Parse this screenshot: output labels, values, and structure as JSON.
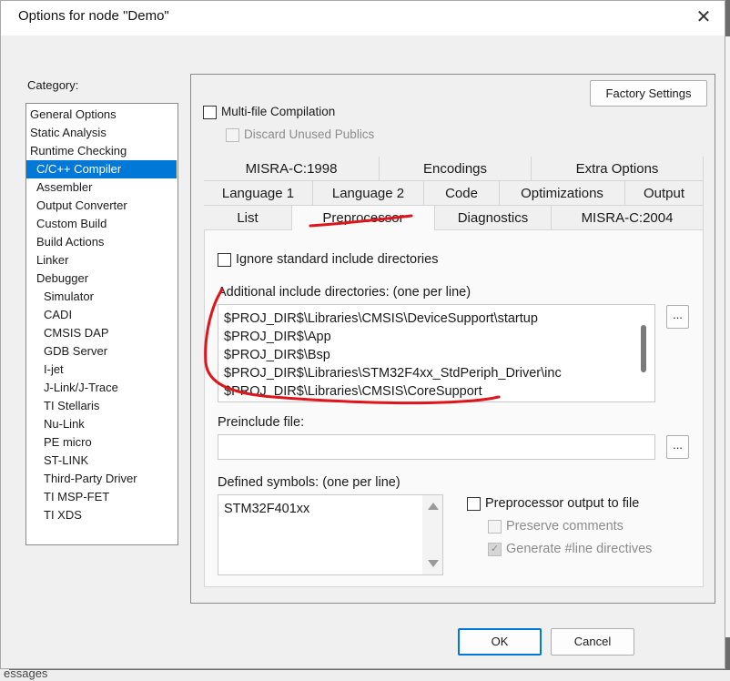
{
  "background": {
    "bottom_text": "essages"
  },
  "dialog": {
    "title": "Options for node \"Demo\"",
    "close_glyph": "✕",
    "category_label": "Category:",
    "categories": [
      {
        "label": "General Options",
        "level": 0
      },
      {
        "label": "Static Analysis",
        "level": 0
      },
      {
        "label": "Runtime Checking",
        "level": 0
      },
      {
        "label": "C/C++ Compiler",
        "level": 1,
        "selected": true
      },
      {
        "label": "Assembler",
        "level": 1
      },
      {
        "label": "Output Converter",
        "level": 1
      },
      {
        "label": "Custom Build",
        "level": 1
      },
      {
        "label": "Build Actions",
        "level": 1
      },
      {
        "label": "Linker",
        "level": 1
      },
      {
        "label": "Debugger",
        "level": 1
      },
      {
        "label": "Simulator",
        "level": 2
      },
      {
        "label": "CADI",
        "level": 2
      },
      {
        "label": "CMSIS DAP",
        "level": 2
      },
      {
        "label": "GDB Server",
        "level": 2
      },
      {
        "label": "I-jet",
        "level": 2
      },
      {
        "label": "J-Link/J-Trace",
        "level": 2
      },
      {
        "label": "TI Stellaris",
        "level": 2
      },
      {
        "label": "Nu-Link",
        "level": 2
      },
      {
        "label": "PE micro",
        "level": 2
      },
      {
        "label": "ST-LINK",
        "level": 2
      },
      {
        "label": "Third-Party Driver",
        "level": 2
      },
      {
        "label": "TI MSP-FET",
        "level": 2
      },
      {
        "label": "TI XDS",
        "level": 2
      }
    ],
    "factory_settings": "Factory Settings",
    "multi_file": "Multi-file Compilation",
    "discard_unused": "Discard Unused Publics",
    "tabs_row1": [
      "MISRA-C:1998",
      "Encodings",
      "Extra Options"
    ],
    "tabs_row2": [
      "Language 1",
      "Language 2",
      "Code",
      "Optimizations",
      "Output"
    ],
    "tabs_row3": [
      "List",
      "Preprocessor",
      "Diagnostics",
      "MISRA-C:2004"
    ],
    "active_tab": "Preprocessor",
    "preprocessor": {
      "ignore_std": "Ignore standard include directories",
      "include_label": "Additional include directories: (one per line)",
      "include_dirs": [
        "$PROJ_DIR$\\Libraries\\CMSIS\\DeviceSupport\\startup",
        "$PROJ_DIR$\\App",
        "$PROJ_DIR$\\Bsp",
        "$PROJ_DIR$\\Libraries\\STM32F4xx_StdPeriph_Driver\\inc",
        "$PROJ_DIR$\\Libraries\\CMSIS\\CoreSupport"
      ],
      "browse_label": "...",
      "preinclude_label": "Preinclude file:",
      "preinclude_value": "",
      "defined_label": "Defined symbols: (one per line)",
      "defined_symbols": [
        "STM32F401xx"
      ],
      "pp_output": "Preprocessor output to file",
      "preserve_comments": "Preserve comments",
      "generate_line": "Generate #line directives"
    },
    "ok": "OK",
    "cancel": "Cancel"
  },
  "colors": {
    "selection": "#0078d7",
    "annotation_red": "#e0151b"
  }
}
